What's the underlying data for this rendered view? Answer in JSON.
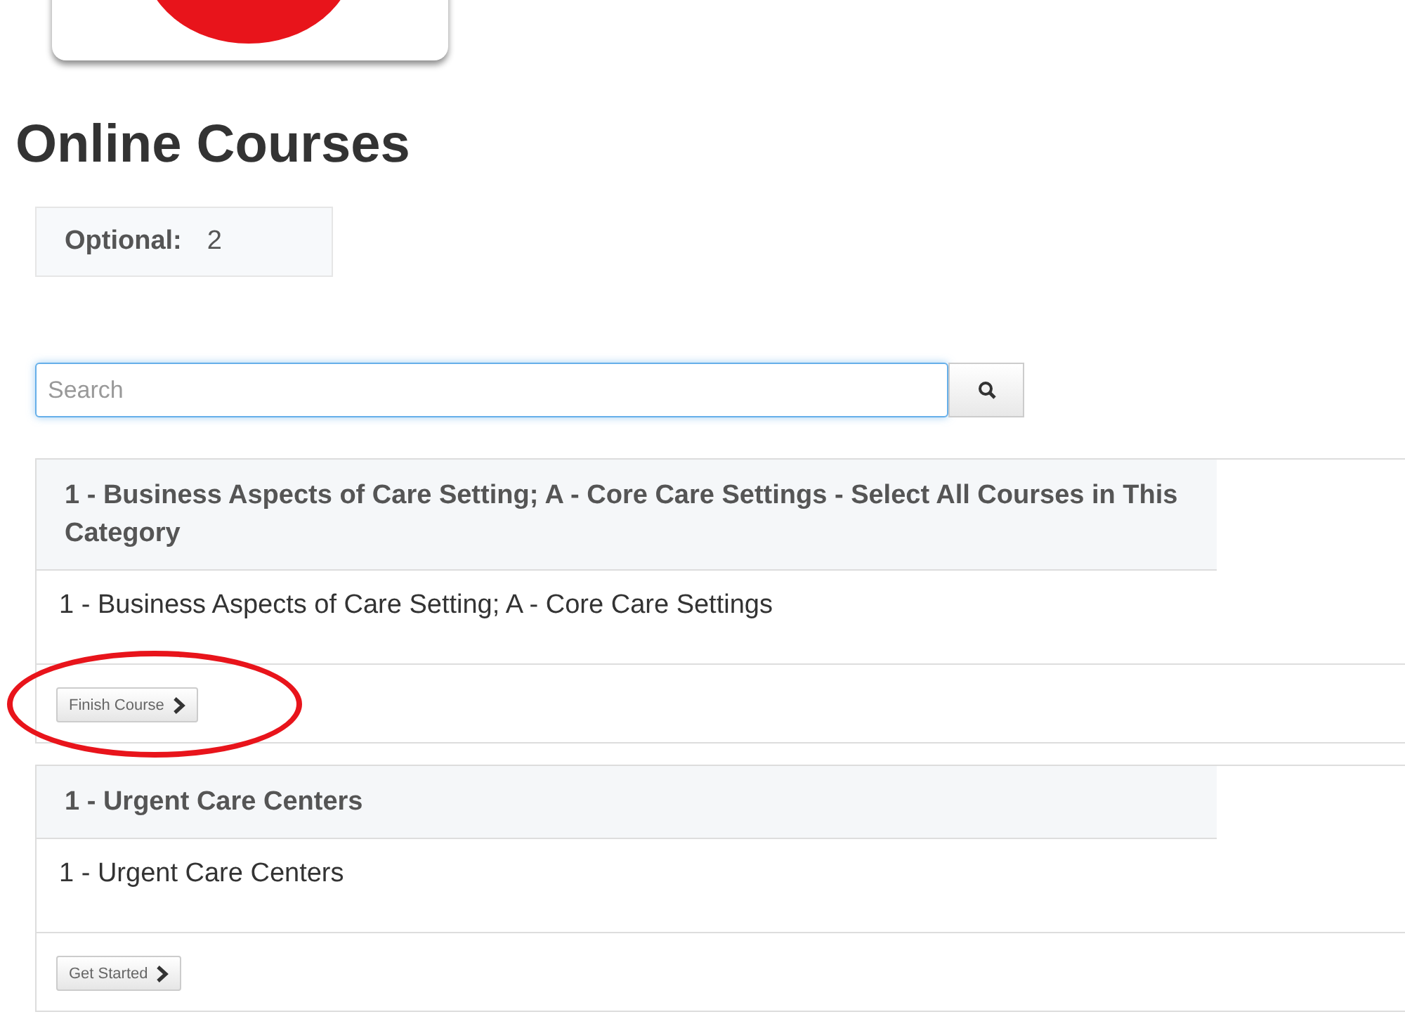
{
  "page_title": "Online Courses",
  "summary": {
    "label": "Optional:",
    "value": "2"
  },
  "search": {
    "placeholder": "Search"
  },
  "categories": [
    {
      "heading": "1 - Business Aspects of Care Setting; A - Core Care Settings - Select All Courses in This Category",
      "course": "1 - Business Aspects of Care Setting; A - Core Care Settings",
      "action": "Finish Course",
      "highlighted": true
    },
    {
      "heading": "1 - Urgent Care Centers",
      "course": "1 - Urgent Care Centers",
      "action": "Get Started",
      "highlighted": false
    }
  ]
}
